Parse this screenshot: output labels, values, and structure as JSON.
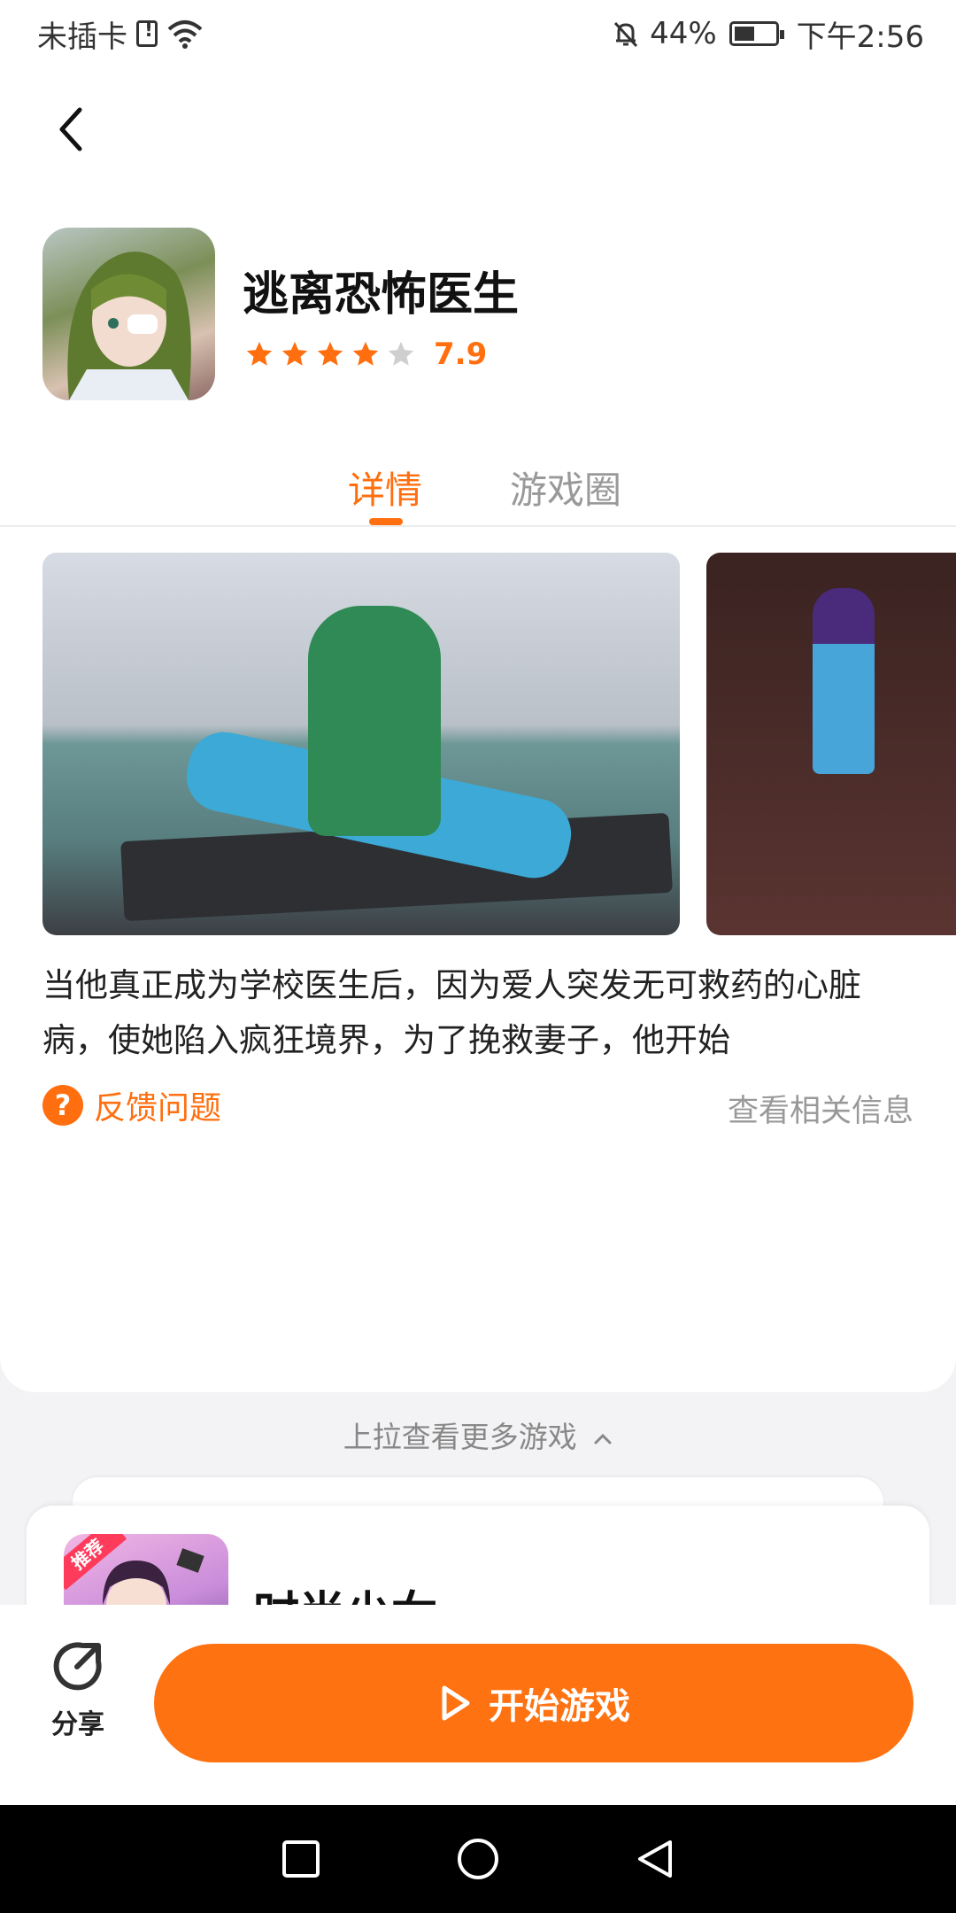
{
  "status_bar": {
    "carrier": "未插卡",
    "battery_percent": "44%",
    "time": "下午2:56",
    "icons": [
      "sim-alert-icon",
      "wifi-icon",
      "bell-off-icon",
      "battery-charging-icon"
    ]
  },
  "header": {
    "back_icon": "chevron-left-icon"
  },
  "app": {
    "title": "逃离恐怖医生",
    "rating_value": "7.9",
    "stars_filled": 4,
    "stars_total": 5
  },
  "tabs": [
    {
      "label": "详情",
      "active": true
    },
    {
      "label": "游戏圈",
      "active": false
    }
  ],
  "description": "当他真正成为学校医生后，因为爱人突发无可救药的心脏病，使她陷入疯狂境界，为了挽救妻子，他开始",
  "feedback": {
    "label": "反馈问题",
    "icon": "question-icon",
    "related_link": "查看相关信息"
  },
  "pull_hint": "上拉查看更多游戏",
  "next_game": {
    "badge": "推荐",
    "title": "时尚少女"
  },
  "bottom_bar": {
    "share_label": "分享",
    "play_label": "开始游戏"
  },
  "colors": {
    "accent": "#ff6f0f",
    "play_button": "#ff7212",
    "background": "#f3f3f5"
  }
}
